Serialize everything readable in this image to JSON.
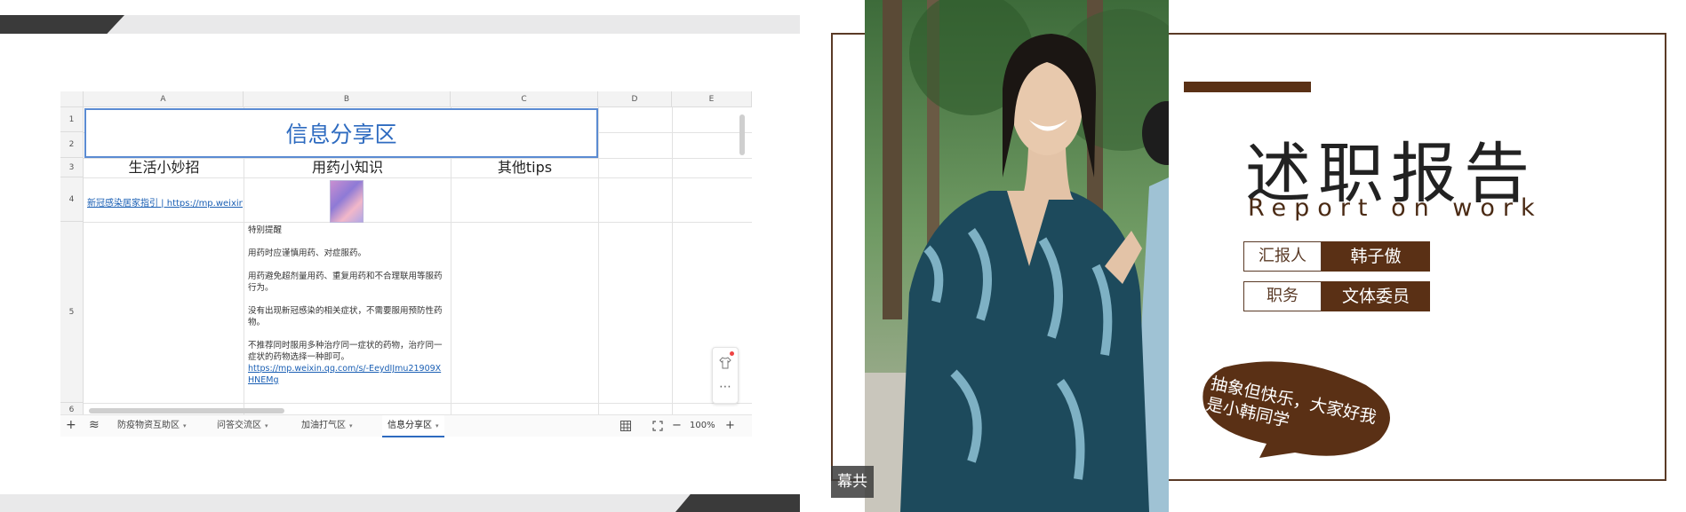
{
  "left_slide": {
    "spreadsheet": {
      "columns": [
        "A",
        "B",
        "C",
        "D",
        "E"
      ],
      "rows": [
        "1",
        "2",
        "3",
        "4",
        "5",
        "6"
      ],
      "title": "信息分享区",
      "col_titles": [
        "生活小妙招",
        "用药小知识",
        "其他tips"
      ],
      "a4_link": "新冠感染居家指引 | https://mp.weixin.qq",
      "b5_notes": {
        "heading": "特别提醒",
        "p1": "用药时应谨慎用药、对症服药。",
        "p2": "用药避免超剂量用药、重复用药和不合理联用等服药行为。",
        "p3": "没有出现新冠感染的相关症状，不需要服用预防性药物。",
        "p4": "不推荐同时服用多种治疗同一症状的药物，治疗同一症状的药物选择一种即可。",
        "link": "https://mp.weixin.qq.com/s/-EeydIJmu21909XHNEMg"
      },
      "more_glyph": "⋯"
    },
    "tabbar": {
      "add": "+",
      "layers": "≋",
      "tabs": [
        {
          "label": "防疫物资互助区",
          "active": false
        },
        {
          "label": "问答交流区",
          "active": false
        },
        {
          "label": "加油打气区",
          "active": false
        },
        {
          "label": "信息分享区",
          "active": true
        }
      ],
      "caret": "▾",
      "zoom": "100%",
      "zoom_minus": "−",
      "zoom_plus": "+"
    }
  },
  "right_slide": {
    "share_badge": "幕共享",
    "title": "述职报告",
    "subtitle": "Report on work",
    "reporter_label": "汇报人",
    "reporter_value": "韩子傲",
    "position_label": "职务",
    "position_value": "文体委员",
    "bubble_text": "抽象但快乐，大家好我是小韩同学",
    "colors": {
      "accent": "#5a3015",
      "frame": "#5a3a26"
    }
  }
}
